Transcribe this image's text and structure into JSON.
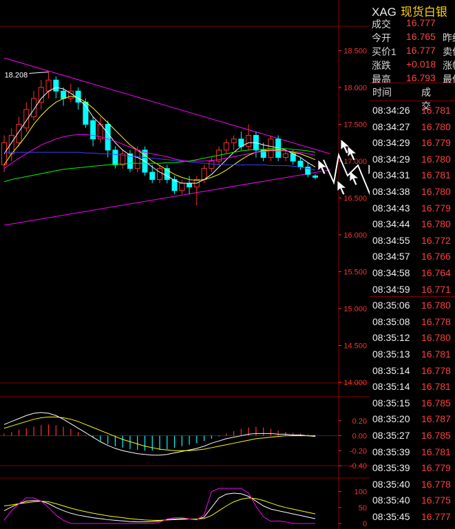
{
  "header": {
    "symbol": "XAG",
    "name": "现货白银"
  },
  "quote": [
    {
      "label": "成交",
      "value": "16.777",
      "label2": ""
    },
    {
      "label": "今开",
      "value": "16.765",
      "label2": "昨结"
    },
    {
      "label": "买价1",
      "value": "16.777",
      "label2": "卖价"
    },
    {
      "label": "涨跌",
      "value": "+0.018",
      "label2": "涨幅"
    },
    {
      "label": "最高",
      "value": "16.793",
      "label2": "最低"
    }
  ],
  "ticks_header": {
    "time": "时间",
    "price": "成交"
  },
  "ticks": [
    {
      "time": "08:34:26",
      "price": "16.781"
    },
    {
      "time": "08:34:27",
      "price": "16.780"
    },
    {
      "time": "08:34:29",
      "price": "16.779"
    },
    {
      "time": "08:34:29",
      "price": "16.780"
    },
    {
      "time": "08:34:31",
      "price": "16.781"
    },
    {
      "time": "08:34:38",
      "price": "16.780"
    },
    {
      "time": "08:34:43",
      "price": "16.779"
    },
    {
      "time": "08:34:44",
      "price": "16.780"
    },
    {
      "time": "08:34:55",
      "price": "16.772"
    },
    {
      "time": "08:34:57",
      "price": "16.766"
    },
    {
      "time": "08:34:58",
      "price": "16.764"
    },
    {
      "time": "08:34:59",
      "price": "16.771"
    },
    {
      "time": "08:35:06",
      "price": "16.780"
    },
    {
      "time": "08:35:08",
      "price": "16.778"
    },
    {
      "time": "08:35:12",
      "price": "16.780"
    },
    {
      "time": "08:35:13",
      "price": "16.781"
    },
    {
      "time": "08:35:14",
      "price": "16.778"
    },
    {
      "time": "08:35:14",
      "price": "16.781"
    },
    {
      "time": "08:35:15",
      "price": "16.785"
    },
    {
      "time": "08:35:20",
      "price": "16.787"
    },
    {
      "time": "08:35:27",
      "price": "16.785"
    },
    {
      "time": "08:35:39",
      "price": "16.781"
    },
    {
      "time": "08:35:39",
      "price": "16.779"
    },
    {
      "time": "08:35:40",
      "price": "16.778"
    },
    {
      "time": "08:35:40",
      "price": "16.775"
    },
    {
      "time": "08:35:45",
      "price": "16.777"
    }
  ],
  "colors": {
    "up": "#ff3030",
    "down": "#00ffff",
    "grid": "#8b0000",
    "axis_text": "#ff3030",
    "ma5": "#ffffff",
    "ma10": "#ffff00",
    "ma20": "#ff00ff",
    "ma30": "#00ff00",
    "ma60": "#4040ff",
    "trendline": "#ff00ff"
  },
  "chart_data": [
    {
      "type": "candlestick",
      "ylim": [
        14.0,
        18.7
      ],
      "yticks": [
        "18.500",
        "18.000",
        "17.500",
        "17.000",
        "16.500",
        "16.000",
        "15.500",
        "15.000",
        "14.500",
        "14.000"
      ],
      "annotation": "18.208",
      "candles": [
        [
          16.95,
          17.25,
          17.35,
          16.85
        ],
        [
          17.1,
          17.35,
          17.45,
          17.0
        ],
        [
          17.25,
          17.5,
          17.6,
          17.2
        ],
        [
          17.45,
          17.7,
          17.8,
          17.4
        ],
        [
          17.6,
          17.85,
          17.95,
          17.55
        ],
        [
          17.8,
          18.0,
          18.1,
          17.7
        ],
        [
          17.95,
          18.1,
          18.21,
          17.85
        ],
        [
          18.1,
          17.95,
          18.15,
          17.85
        ],
        [
          17.95,
          17.85,
          18.0,
          17.75
        ],
        [
          17.85,
          17.95,
          18.05,
          17.8
        ],
        [
          17.95,
          17.8,
          18.0,
          17.7
        ],
        [
          17.8,
          17.5,
          17.85,
          17.45
        ],
        [
          17.55,
          17.3,
          17.6,
          17.2
        ],
        [
          17.3,
          17.5,
          17.6,
          17.25
        ],
        [
          17.5,
          17.15,
          17.55,
          17.05
        ],
        [
          17.15,
          16.95,
          17.2,
          16.9
        ],
        [
          16.95,
          17.1,
          17.15,
          16.9
        ],
        [
          17.1,
          16.9,
          17.15,
          16.85
        ],
        [
          16.9,
          17.15,
          17.2,
          16.85
        ],
        [
          17.15,
          16.85,
          17.2,
          16.8
        ],
        [
          16.85,
          16.75,
          16.95,
          16.7
        ],
        [
          16.75,
          16.9,
          16.95,
          16.7
        ],
        [
          16.9,
          16.75,
          16.95,
          16.7
        ],
        [
          16.75,
          16.6,
          16.8,
          16.55
        ],
        [
          16.6,
          16.7,
          16.75,
          16.55
        ],
        [
          16.7,
          16.65,
          16.8,
          16.55
        ],
        [
          16.65,
          16.75,
          16.8,
          16.4
        ],
        [
          16.75,
          16.9,
          16.95,
          16.7
        ],
        [
          16.9,
          17.0,
          17.05,
          16.85
        ],
        [
          17.0,
          17.15,
          17.2,
          16.95
        ],
        [
          17.15,
          17.25,
          17.3,
          17.1
        ],
        [
          17.25,
          17.3,
          17.35,
          17.15
        ],
        [
          17.3,
          17.2,
          17.4,
          17.15
        ],
        [
          17.2,
          17.35,
          17.5,
          17.15
        ],
        [
          17.35,
          17.15,
          17.4,
          17.05
        ],
        [
          17.15,
          17.05,
          17.25,
          17.0
        ],
        [
          17.05,
          17.3,
          17.35,
          17.0
        ],
        [
          17.3,
          17.05,
          17.35,
          17.0
        ],
        [
          17.05,
          17.1,
          17.15,
          17.0
        ],
        [
          17.1,
          17.0,
          17.15,
          16.95
        ],
        [
          17.0,
          16.92,
          17.05,
          16.88
        ],
        [
          16.92,
          16.82,
          16.98,
          16.78
        ],
        [
          16.8,
          16.78,
          16.82,
          16.75
        ]
      ],
      "series": [
        {
          "name": "MA5",
          "values": [
            17.1,
            17.25,
            17.4,
            17.55,
            17.7,
            17.85,
            17.95,
            18.0,
            17.98,
            17.92,
            17.85,
            17.75,
            17.6,
            17.5,
            17.38,
            17.25,
            17.15,
            17.08,
            17.05,
            17.0,
            16.92,
            16.85,
            16.8,
            16.74,
            16.7,
            16.7,
            16.7,
            16.75,
            16.82,
            16.92,
            17.02,
            17.12,
            17.2,
            17.25,
            17.25,
            17.22,
            17.2,
            17.18,
            17.15,
            17.1,
            17.05,
            16.98,
            16.92
          ]
        },
        {
          "name": "MA10",
          "values": [
            16.95,
            17.1,
            17.22,
            17.35,
            17.5,
            17.62,
            17.72,
            17.8,
            17.85,
            17.88,
            17.86,
            17.8,
            17.72,
            17.62,
            17.52,
            17.42,
            17.32,
            17.22,
            17.15,
            17.08,
            17.0,
            16.94,
            16.88,
            16.82,
            16.78,
            16.75,
            16.74,
            16.75,
            16.78,
            16.82,
            16.88,
            16.95,
            17.02,
            17.08,
            17.12,
            17.14,
            17.15,
            17.15,
            17.14,
            17.12,
            17.1,
            17.06,
            17.02
          ]
        },
        {
          "name": "MA20",
          "values": [
            16.9,
            16.97,
            17.04,
            17.1,
            17.16,
            17.22,
            17.26,
            17.3,
            17.33,
            17.35,
            17.36,
            17.36,
            17.35,
            17.33,
            17.3,
            17.27,
            17.23,
            17.19,
            17.15,
            17.12,
            17.1,
            17.08,
            17.06,
            17.03,
            17.01,
            17.0,
            17.0,
            17.0,
            17.01,
            17.02,
            17.04,
            17.06,
            17.08,
            17.1,
            17.12,
            17.13,
            17.14,
            17.14,
            17.14,
            17.13,
            17.12,
            17.1,
            17.08
          ]
        },
        {
          "name": "MA30",
          "values": [
            16.72,
            16.75,
            16.77,
            16.79,
            16.81,
            16.83,
            16.85,
            16.87,
            16.89,
            16.9,
            16.91,
            16.92,
            16.93,
            16.94,
            16.95,
            16.96,
            16.96,
            16.97,
            16.97,
            16.97,
            16.97,
            16.97,
            16.98,
            16.98,
            16.99,
            17.0,
            17.02,
            17.04,
            17.06,
            17.08,
            17.1,
            17.12,
            17.14,
            17.15,
            17.16,
            17.16,
            17.17,
            17.17,
            17.17,
            17.16,
            17.15,
            17.14,
            17.12
          ]
        },
        {
          "name": "MA60",
          "values": [
            17.12,
            17.12,
            17.12,
            17.12,
            17.12,
            17.12,
            17.12,
            17.12,
            17.12,
            17.12,
            17.12,
            17.11,
            17.11,
            17.1,
            17.1,
            17.09,
            17.08,
            17.07,
            17.06,
            17.05,
            17.04,
            17.03,
            17.02,
            17.01,
            17.0,
            16.99,
            16.98,
            16.97,
            16.96,
            16.95,
            16.95,
            16.95,
            16.95,
            16.95,
            16.95,
            16.95,
            16.94,
            16.94,
            16.94,
            16.93,
            16.92,
            16.9,
            16.88
          ]
        }
      ],
      "trendlines": [
        {
          "from": [
            0,
            18.4
          ],
          "to": [
            44,
            17.1
          ]
        },
        {
          "from": [
            0,
            16.13
          ],
          "to": [
            44,
            16.88
          ]
        }
      ]
    },
    {
      "type": "macd",
      "ylim": [
        -0.4,
        0.3
      ],
      "yticks": [
        "0.20",
        "0.00",
        "-0.20",
        "-0.40"
      ],
      "bars": [
        0.03,
        0.05,
        0.08,
        0.1,
        0.12,
        0.14,
        0.15,
        0.14,
        0.12,
        0.09,
        0.05,
        0.01,
        -0.03,
        -0.07,
        -0.11,
        -0.14,
        -0.16,
        -0.18,
        -0.19,
        -0.2,
        -0.2,
        -0.19,
        -0.18,
        -0.16,
        -0.14,
        -0.12,
        -0.1,
        -0.07,
        -0.04,
        -0.01,
        0.03,
        0.06,
        0.09,
        0.11,
        0.12,
        0.11,
        0.09,
        0.07,
        0.05,
        0.04,
        0.03,
        0.02,
        0.01
      ],
      "series": [
        {
          "name": "DIF",
          "values": [
            0.15,
            0.19,
            0.23,
            0.27,
            0.3,
            0.31,
            0.3,
            0.27,
            0.22,
            0.16,
            0.1,
            0.04,
            -0.02,
            -0.08,
            -0.13,
            -0.17,
            -0.2,
            -0.22,
            -0.24,
            -0.25,
            -0.26,
            -0.26,
            -0.25,
            -0.23,
            -0.21,
            -0.19,
            -0.17,
            -0.14,
            -0.1,
            -0.07,
            -0.04,
            -0.02,
            0.0,
            0.02,
            0.03,
            0.03,
            0.03,
            0.02,
            0.02,
            0.01,
            0.01,
            0.0,
            -0.01
          ]
        },
        {
          "name": "DEA",
          "values": [
            0.1,
            0.13,
            0.16,
            0.19,
            0.22,
            0.24,
            0.25,
            0.25,
            0.24,
            0.22,
            0.19,
            0.15,
            0.11,
            0.07,
            0.03,
            -0.01,
            -0.05,
            -0.08,
            -0.11,
            -0.14,
            -0.16,
            -0.18,
            -0.19,
            -0.2,
            -0.2,
            -0.2,
            -0.19,
            -0.18,
            -0.16,
            -0.14,
            -0.12,
            -0.1,
            -0.08,
            -0.06,
            -0.04,
            -0.03,
            -0.02,
            -0.01,
            0.0,
            0.0,
            0.0,
            0.0,
            0.0
          ]
        }
      ]
    },
    {
      "type": "line",
      "ylim": [
        0,
        110
      ],
      "yticks": [
        "100",
        "50",
        "0"
      ],
      "series": [
        {
          "name": "K",
          "values": [
            40,
            52,
            62,
            70,
            72,
            70,
            62,
            50,
            40,
            32,
            26,
            22,
            18,
            15,
            12,
            10,
            8,
            6,
            5,
            5,
            6,
            8,
            12,
            14,
            15,
            14,
            13,
            20,
            50,
            80,
            92,
            95,
            93,
            85,
            70,
            55,
            45,
            40,
            35,
            30,
            25,
            20,
            15
          ]
        },
        {
          "name": "D",
          "values": [
            55,
            58,
            62,
            65,
            68,
            70,
            68,
            62,
            55,
            48,
            42,
            37,
            32,
            28,
            24,
            21,
            18,
            15,
            13,
            11,
            10,
            10,
            11,
            12,
            13,
            14,
            14,
            16,
            25,
            40,
            55,
            68,
            76,
            80,
            78,
            72,
            64,
            56,
            50,
            45,
            40,
            35,
            30
          ]
        },
        {
          "name": "J",
          "values": [
            10,
            40,
            62,
            80,
            80,
            70,
            50,
            26,
            10,
            0,
            0,
            0,
            0,
            0,
            0,
            0,
            0,
            0,
            0,
            0,
            0,
            4,
            14,
            18,
            19,
            14,
            11,
            28,
            100,
            110,
            110,
            110,
            110,
            95,
            54,
            21,
            7,
            8,
            5,
            0,
            0,
            0,
            0
          ]
        }
      ]
    }
  ]
}
